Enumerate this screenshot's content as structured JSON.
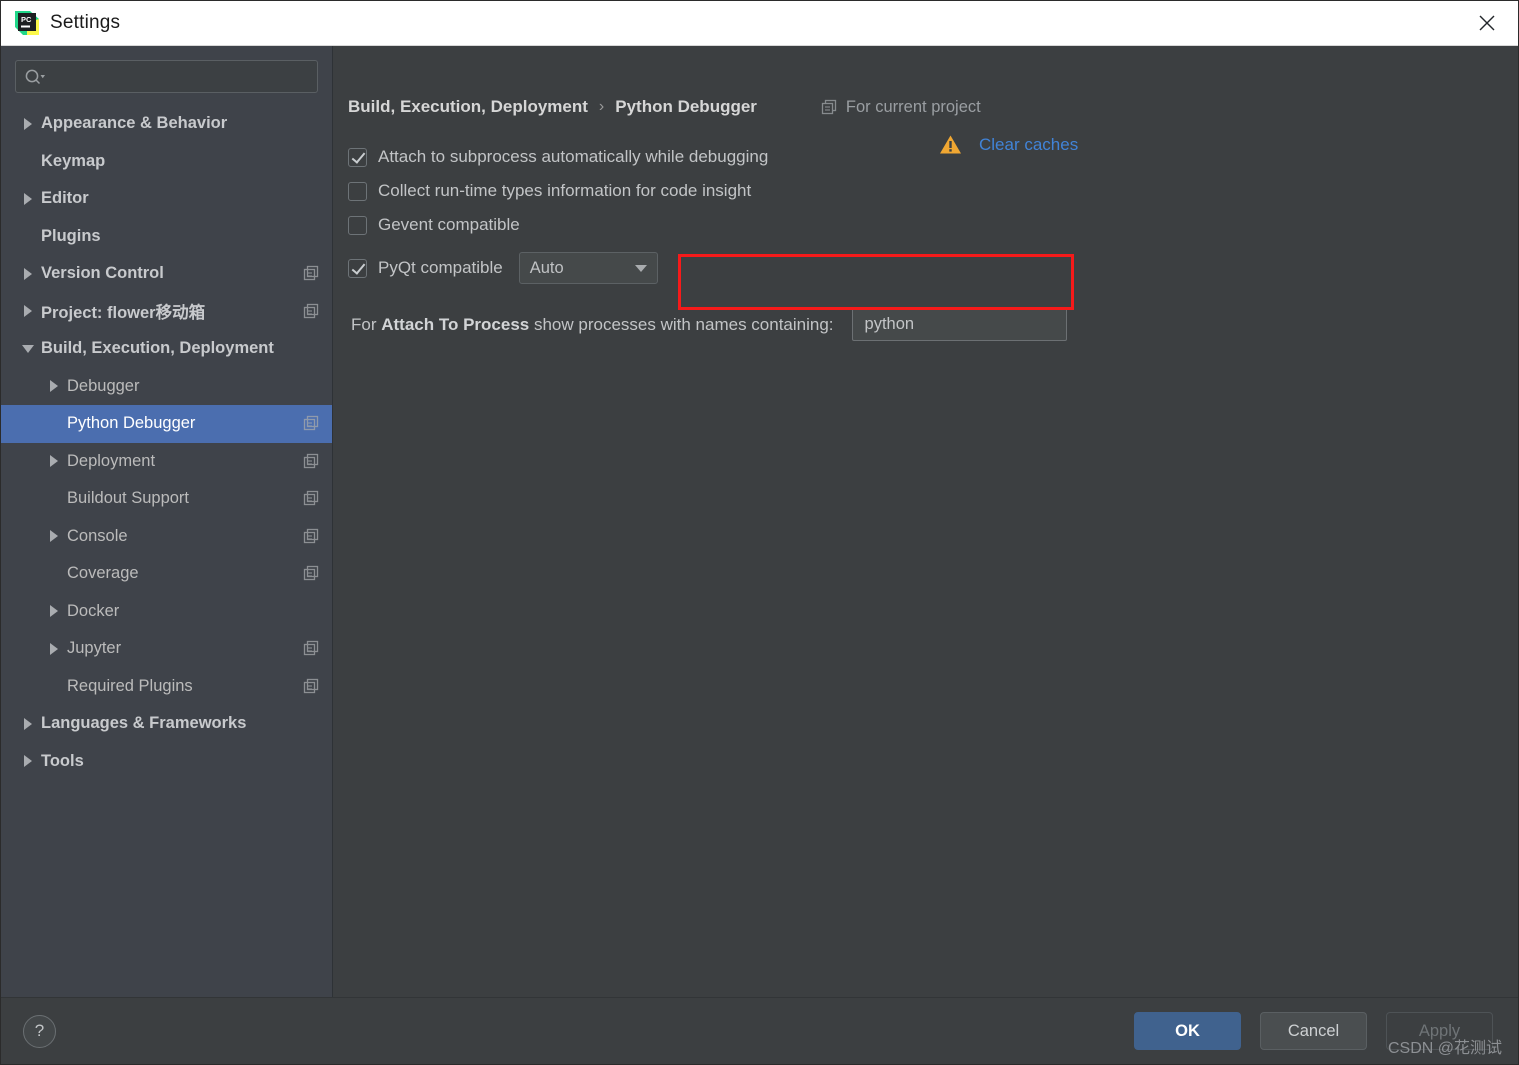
{
  "window": {
    "title": "Settings",
    "logo_icon": "pycharm-logo-icon",
    "close_icon": "close-icon"
  },
  "sidebar": {
    "search": {
      "value": "",
      "placeholder": "",
      "icon": "search-icon"
    },
    "items": [
      {
        "label": "Appearance & Behavior",
        "level": 0,
        "arrow": "right",
        "copy": false,
        "selected": false
      },
      {
        "label": "Keymap",
        "level": 0,
        "arrow": "none",
        "copy": false,
        "selected": false
      },
      {
        "label": "Editor",
        "level": 0,
        "arrow": "right",
        "copy": false,
        "selected": false
      },
      {
        "label": "Plugins",
        "level": 0,
        "arrow": "none",
        "copy": false,
        "selected": false
      },
      {
        "label": "Version Control",
        "level": 0,
        "arrow": "right",
        "copy": true,
        "selected": false
      },
      {
        "label": "Project: flower移动箱",
        "level": 0,
        "arrow": "right",
        "copy": true,
        "selected": false
      },
      {
        "label": "Build, Execution, Deployment",
        "level": 0,
        "arrow": "down",
        "copy": false,
        "selected": false
      },
      {
        "label": "Debugger",
        "level": 1,
        "arrow": "right",
        "copy": false,
        "selected": false
      },
      {
        "label": "Python Debugger",
        "level": 1,
        "arrow": "none",
        "copy": true,
        "selected": true
      },
      {
        "label": "Deployment",
        "level": 1,
        "arrow": "right",
        "copy": true,
        "selected": false
      },
      {
        "label": "Buildout Support",
        "level": 1,
        "arrow": "none",
        "copy": true,
        "selected": false
      },
      {
        "label": "Console",
        "level": 1,
        "arrow": "right",
        "copy": true,
        "selected": false
      },
      {
        "label": "Coverage",
        "level": 1,
        "arrow": "none",
        "copy": true,
        "selected": false
      },
      {
        "label": "Docker",
        "level": 1,
        "arrow": "right",
        "copy": false,
        "selected": false
      },
      {
        "label": "Jupyter",
        "level": 1,
        "arrow": "right",
        "copy": true,
        "selected": false
      },
      {
        "label": "Required Plugins",
        "level": 1,
        "arrow": "none",
        "copy": true,
        "selected": false
      },
      {
        "label": "Languages & Frameworks",
        "level": 0,
        "arrow": "right",
        "copy": false,
        "selected": false
      },
      {
        "label": "Tools",
        "level": 0,
        "arrow": "right",
        "copy": false,
        "selected": false
      }
    ]
  },
  "main": {
    "breadcrumb": {
      "parent": "Build, Execution, Deployment",
      "separator": "›",
      "current": "Python Debugger"
    },
    "for_project": {
      "label": "For current project",
      "icon": "copy-icon"
    },
    "checkboxes": [
      {
        "label": "Attach to subprocess automatically while debugging",
        "checked": true
      },
      {
        "label": "Collect run-time types information for code insight",
        "checked": false
      },
      {
        "label": "Gevent compatible",
        "checked": false
      }
    ],
    "pyqt": {
      "label": "PyQt compatible",
      "checked": true,
      "combo_value": "Auto",
      "combo_icon": "chevron-down-icon",
      "highlight_color": "#f61a1a"
    },
    "clear_caches": {
      "label": "Clear caches",
      "icon": "warning-icon",
      "link_color": "#4183d7",
      "warn_color": "#f0a732"
    },
    "attach_to_process": {
      "prefix": "For ",
      "bold": "Attach To Process",
      "suffix": " show processes with names containing:",
      "field_value": "python"
    }
  },
  "footer": {
    "help_label": "?",
    "ok_label": "OK",
    "cancel_label": "Cancel",
    "apply_label": "Apply",
    "watermark": "CSDN @花测试",
    "ok_color": "#40628e"
  }
}
